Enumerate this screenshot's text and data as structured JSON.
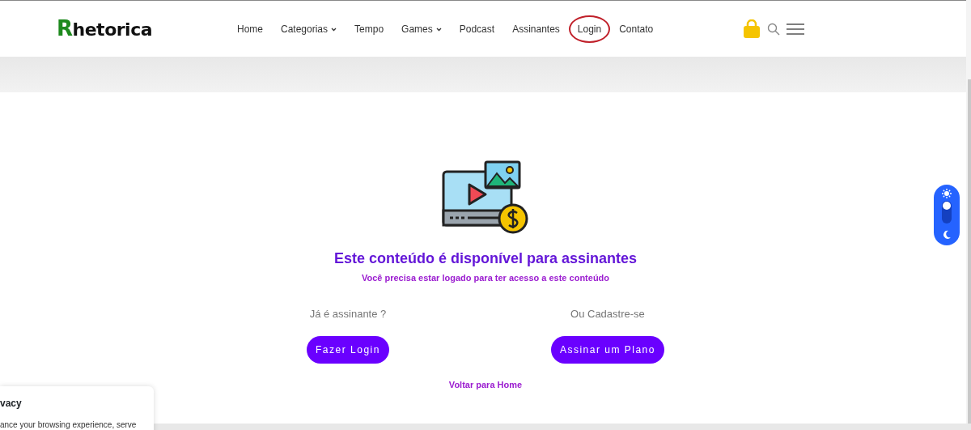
{
  "logo": {
    "initial": "R",
    "rest": "hetorica"
  },
  "nav": [
    {
      "label": "Home",
      "dropdown": false,
      "highlighted": false
    },
    {
      "label": "Categorias",
      "dropdown": true,
      "highlighted": false
    },
    {
      "label": "Tempo",
      "dropdown": false,
      "highlighted": false
    },
    {
      "label": "Games",
      "dropdown": true,
      "highlighted": false
    },
    {
      "label": "Podcast",
      "dropdown": false,
      "highlighted": false
    },
    {
      "label": "Assinantes",
      "dropdown": false,
      "highlighted": false
    },
    {
      "label": "Login",
      "dropdown": false,
      "highlighted": true
    },
    {
      "label": "Contato",
      "dropdown": false,
      "highlighted": false
    }
  ],
  "notice": {
    "title": "Este conteúdo é disponível para assinantes",
    "subtitle": "Você precisa estar logado para ter acesso a este conteúdo"
  },
  "options": [
    {
      "prompt": "Já é assinante ?",
      "button": "Fazer Login"
    },
    {
      "prompt": "Ou Cadastre-se",
      "button": "Assinar um Plano"
    }
  ],
  "back_link": "Voltar para Home",
  "theme_toggle": {
    "dark": false
  },
  "privacy": {
    "title": "vacy",
    "text": "ance your browsing experience, serve"
  }
}
